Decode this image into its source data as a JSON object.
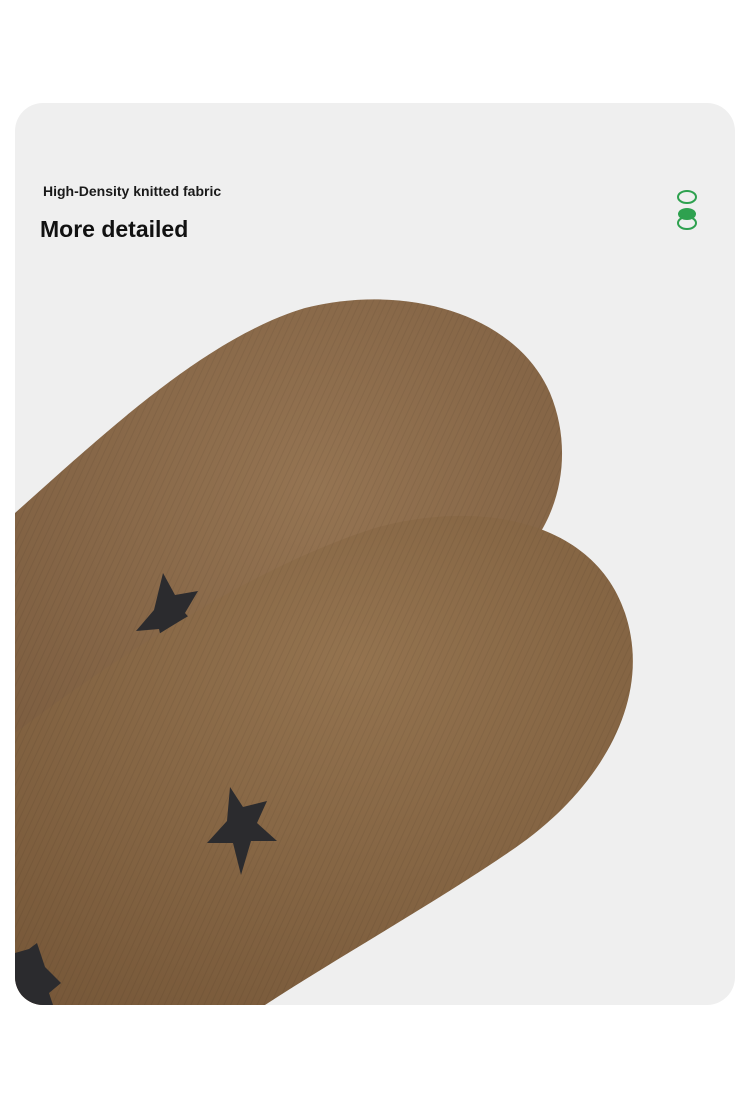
{
  "caption": {
    "subtitle": "High-Density knitted fabric",
    "title": "More detailed"
  },
  "image": {
    "subject": "brown socks with black star pattern",
    "sock_color": "#8a6a4a",
    "star_color": "#2b2b2e",
    "background_color": "#efefef"
  },
  "indicator": {
    "accent_color": "#2ea14f",
    "active_index": 1
  }
}
